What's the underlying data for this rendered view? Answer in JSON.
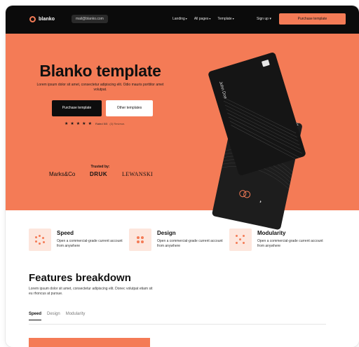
{
  "header": {
    "brand": "blanko",
    "url_pill": "mail@blanko.com",
    "menu": [
      {
        "label": "Landing",
        "caret": "▾"
      },
      {
        "label": "All pages",
        "caret": "▾"
      },
      {
        "label": "Template",
        "caret": "▾"
      }
    ],
    "signup": "Sign up ▾",
    "cta": "Purchase template"
  },
  "hero": {
    "title": "Blanko template",
    "subtitle": "Lorem ipsum dolor sit amet, consectetur adipiscing elit. Odio mauris porttitor amet volutpat.",
    "btn_primary": "Purchase template",
    "btn_secondary": "Other templates",
    "stars": "★",
    "rating_text": "Rated 5/5",
    "rating_reviews": "(3) Reviews",
    "trusted_by": "Trusted by:",
    "logos": [
      "Marks&Co",
      "DRUK",
      "LEWANSKI"
    ],
    "card_name": "John Doe",
    "card_number": "1234 5**",
    "contactless": "◗"
  },
  "features": [
    {
      "title": "Speed",
      "desc": "Open a commercial-grade current account from anywhere",
      "icon": "dots-ring-icon"
    },
    {
      "title": "Design",
      "desc": "Open a commercial-grade current account from anywhere",
      "icon": "four-dots-icon"
    },
    {
      "title": "Modularity",
      "desc": "Open a commercial-grade current account from anywhere",
      "icon": "dot-grid-icon"
    }
  ],
  "breakdown": {
    "title": "Features breakdown",
    "subtitle": "Lorem ipsum dolor sit amet, consectetur adipiscing elit. Donec volutpat etiam sit eu rhoncus at pursue.",
    "tabs": [
      "Speed",
      "Design",
      "Modularity"
    ]
  },
  "colors": {
    "accent": "#f47b56",
    "dark": "#0b0b0b",
    "tint": "#fde6dd"
  }
}
